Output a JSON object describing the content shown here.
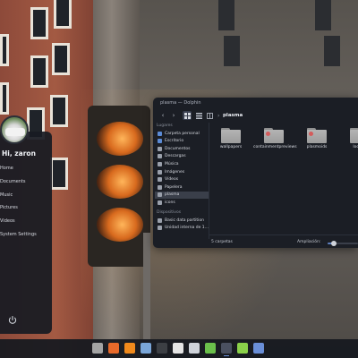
{
  "launcher": {
    "greeting": "Hi, zaron",
    "items": [
      {
        "label": "Home",
        "name": "launcher-item-home"
      },
      {
        "label": "Documents",
        "name": "launcher-item-documents"
      },
      {
        "label": "Music",
        "name": "launcher-item-music"
      },
      {
        "label": "Pictures",
        "name": "launcher-item-pictures"
      },
      {
        "label": "Videos",
        "name": "launcher-item-videos"
      },
      {
        "label": "System Settings",
        "name": "launcher-item-system-settings"
      }
    ],
    "power_icon": "power-icon"
  },
  "dolphin": {
    "title": "plasma — Dolphin",
    "breadcrumb": "plasma",
    "toolbar_icons": [
      "back-icon",
      "forward-icon",
      "icon-view-icon",
      "compact-view-icon",
      "split-view-icon"
    ],
    "places": {
      "header_places": "Lugares",
      "items": [
        {
          "label": "Carpeta personal",
          "color": "#5b8bd6"
        },
        {
          "label": "Escritorio",
          "color": "#5b8bd6"
        },
        {
          "label": "Documentos",
          "color": "#9aa0ab"
        },
        {
          "label": "Descargas",
          "color": "#9aa0ab"
        },
        {
          "label": "Música",
          "color": "#9aa0ab"
        },
        {
          "label": "Imágenes",
          "color": "#9aa0ab"
        },
        {
          "label": "Vídeos",
          "color": "#9aa0ab"
        },
        {
          "label": "Papelera",
          "color": "#9aa0ab"
        },
        {
          "label": "plasma",
          "color": "#9aa0ab",
          "selected": true
        },
        {
          "label": "icons",
          "color": "#9aa0ab"
        }
      ],
      "header_devices": "Dispositivos",
      "devices": [
        {
          "label": "Basic data partition",
          "color": "#9aa0ab"
        },
        {
          "label": "Unidad interna de 1...",
          "color": "#9aa0ab"
        }
      ]
    },
    "files": [
      {
        "label": "wallpapers",
        "emblem": false
      },
      {
        "label": "containmentpreviews",
        "emblem": true
      },
      {
        "label": "plasmoids",
        "emblem": true
      },
      {
        "label": "look-...",
        "emblem": false
      }
    ],
    "status": {
      "count": "5 carpetas",
      "zoom_label": "Ampliación:",
      "zoom_level": 0.2
    }
  },
  "taskbar": {
    "apps": [
      {
        "icon": "file-manager-icon",
        "color": "#a4a4a4"
      },
      {
        "icon": "firefox-icon",
        "color": "#e86a2a"
      },
      {
        "icon": "vlc-icon",
        "color": "#f08a1c"
      },
      {
        "icon": "image-viewer-icon",
        "color": "#7aa6d8"
      },
      {
        "icon": "terminal-icon",
        "color": "#3c3f44"
      },
      {
        "icon": "text-editor-icon",
        "color": "#e5e5e5"
      },
      {
        "icon": "settings-icon",
        "color": "#cfd3da"
      },
      {
        "icon": "spreadsheet-icon",
        "color": "#6bc04b"
      },
      {
        "icon": "app-launcher-icon",
        "color": "#4a5060"
      },
      {
        "icon": "calc-icon",
        "color": "#8bd14a"
      },
      {
        "icon": "notes-icon",
        "color": "#6a8fd8"
      }
    ]
  }
}
